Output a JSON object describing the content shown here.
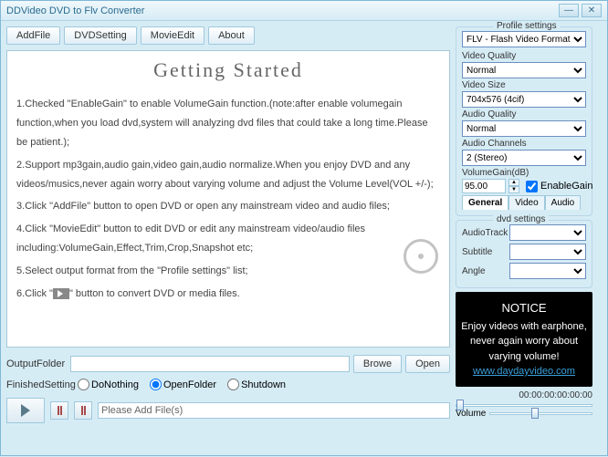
{
  "titlebar": {
    "title": "DDVideo DVD to Flv Converter"
  },
  "toolbar": {
    "addfile": "AddFile",
    "dvdsetting": "DVDSetting",
    "movieedit": "MovieEdit",
    "about": "About"
  },
  "content": {
    "heading": "Getting Started",
    "steps": [
      "Checked \"EnableGain\" to enable VolumeGain function.(note:after enable volumegain function,when you load dvd,system will analyzing dvd files that could take a long time.Please be patient.);",
      "Support mp3gain,audio gain,video gain,audio normalize.When you enjoy DVD and any videos/musics,never again worry about varying volume and adjust the Volume Level(VOL +/-);",
      "Click \"AddFile\" button to open DVD or open any mainstream video and audio files;",
      "Click \"MovieEdit\" button to edit DVD or edit any mainstream video/audio files including:VolumeGain,Effect,Trim,Crop,Snapshot etc;",
      "Select output format from the \"Profile settings\" list;",
      "Click \"    \" button to convert DVD or media files."
    ]
  },
  "output": {
    "label": "OutputFolder",
    "value": "",
    "browse": "Browe",
    "open": "Open"
  },
  "finished": {
    "label": "FinishedSetting",
    "donothing": "DoNothing",
    "openfolder": "OpenFolder",
    "shutdown": "Shutdown",
    "selected": "OpenFolder"
  },
  "player": {
    "status": "Please Add File(s)"
  },
  "profile": {
    "group_title": "Profile settings",
    "format": "FLV - Flash Video Format",
    "video_quality_label": "Video Quality",
    "video_quality": "Normal",
    "video_size_label": "Video Size",
    "video_size": "704x576 (4cif)",
    "audio_quality_label": "Audio Quality",
    "audio_quality": "Normal",
    "audio_channels_label": "Audio Channels",
    "audio_channels": "2 (Stereo)",
    "volumegain_label": "VolumeGain(dB)",
    "volumegain": "95.00",
    "enablegain": "EnableGain",
    "tabs": {
      "general": "General",
      "video": "Video",
      "audio": "Audio"
    }
  },
  "dvd": {
    "group_title": "dvd settings",
    "audiotrack_label": "AudioTrack",
    "subtitle_label": "Subtitle",
    "angle_label": "Angle"
  },
  "notice": {
    "title": "NOTICE",
    "body": "Enjoy videos with earphone, never again worry about varying volume!",
    "link": "www.daydayvideo.com"
  },
  "time": "00:00:00:00:00:00",
  "volume_label": "Volume"
}
